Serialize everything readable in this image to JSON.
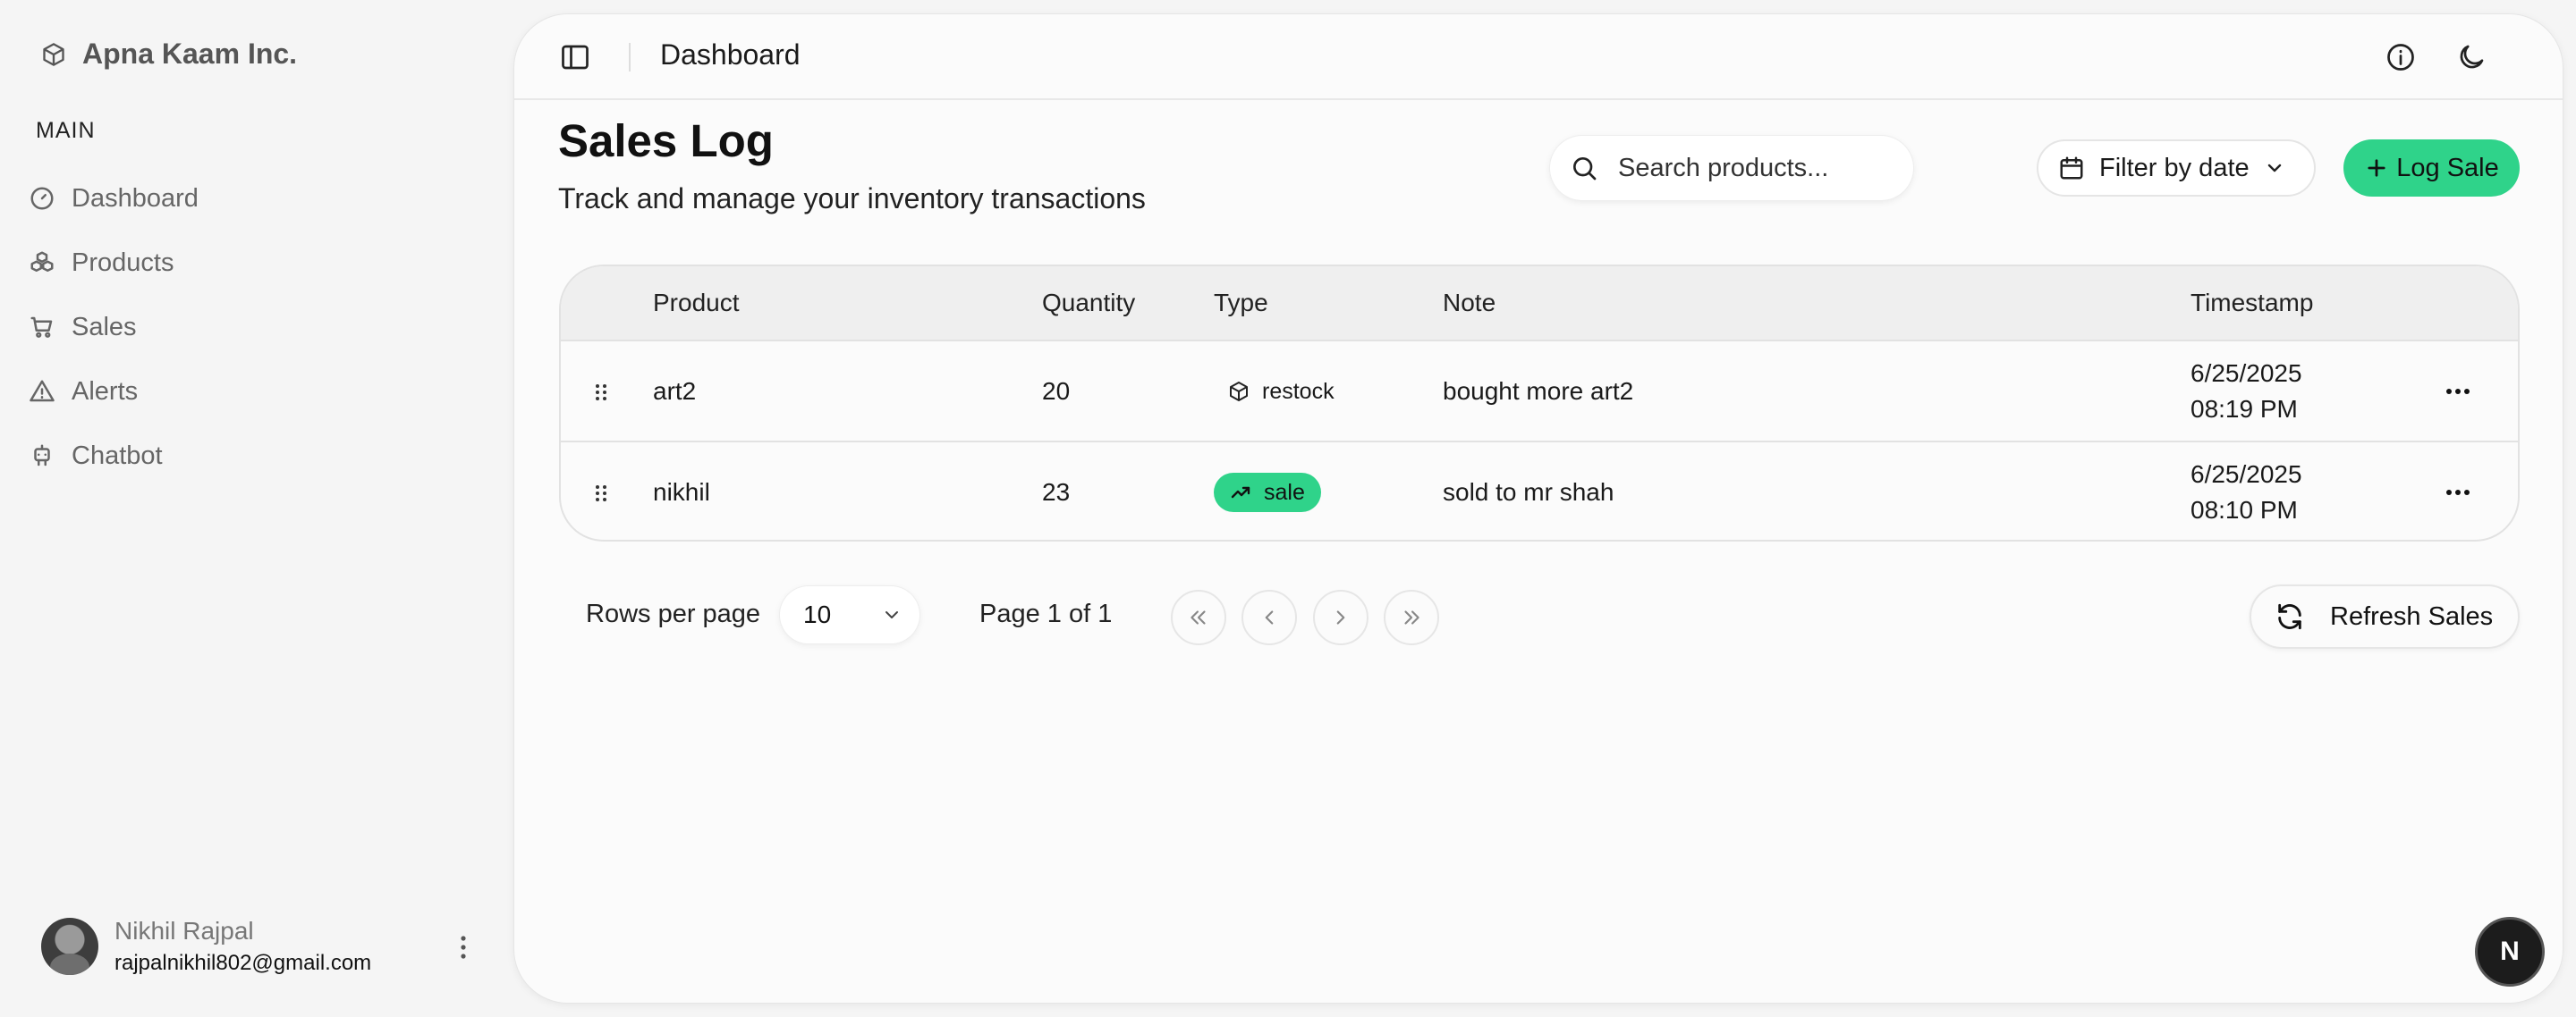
{
  "brand": {
    "name": "Apna Kaam Inc.",
    "icon": "package-icon"
  },
  "sidebar": {
    "section_label": "MAIN",
    "items": [
      {
        "label": "Dashboard",
        "icon": "gauge-icon"
      },
      {
        "label": "Products",
        "icon": "boxes-icon"
      },
      {
        "label": "Sales",
        "icon": "cart-icon"
      },
      {
        "label": "Alerts",
        "icon": "alert-triangle-icon"
      },
      {
        "label": "Chatbot",
        "icon": "bot-icon"
      }
    ],
    "user": {
      "name": "Nikhil Rajpal",
      "email": "rajpalnikhil802@gmail.com"
    }
  },
  "header": {
    "title": "Dashboard"
  },
  "page": {
    "title": "Sales Log",
    "subtitle": "Track and manage your inventory transactions"
  },
  "toolbar": {
    "search_placeholder": "Search products...",
    "filter_label": "Filter by date",
    "log_sale_label": "Log Sale"
  },
  "table": {
    "columns": {
      "product": "Product",
      "quantity": "Quantity",
      "type": "Type",
      "note": "Note",
      "timestamp": "Timestamp"
    },
    "rows": [
      {
        "product": "art2",
        "quantity": "20",
        "type": "restock",
        "note": "bought more art2",
        "date": "6/25/2025",
        "time": "08:19 PM"
      },
      {
        "product": "nikhil",
        "quantity": "23",
        "type": "sale",
        "note": "sold to mr shah",
        "date": "6/25/2025",
        "time": "08:10 PM"
      }
    ]
  },
  "pagination": {
    "rows_per_page_label": "Rows per page",
    "rows_per_page_value": "10",
    "page_info": "Page 1 of 1"
  },
  "refresh_label": "Refresh Sales",
  "dev_badge": "N",
  "colors": {
    "accent": "#2fd38a",
    "background": "#f5f5f5",
    "card": "#fbfbfb"
  }
}
